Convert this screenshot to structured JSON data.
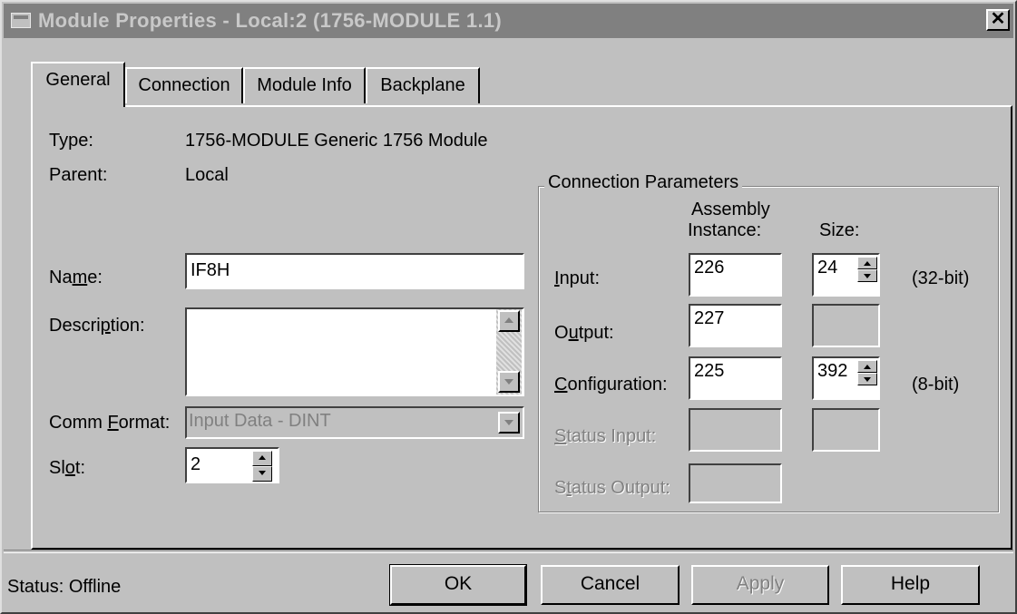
{
  "window": {
    "title": "Module Properties - Local:2 (1756-MODULE 1.1)",
    "close_glyph": "✕"
  },
  "tabs": [
    {
      "label": "General",
      "active": true
    },
    {
      "label": "Connection",
      "active": false
    },
    {
      "label": "Module Info",
      "active": false
    },
    {
      "label": "Backplane",
      "active": false
    }
  ],
  "general": {
    "type_label": "Type:",
    "type_value": "1756-MODULE Generic 1756 Module",
    "parent_label": "Parent:",
    "parent_value": "Local",
    "name_label_pre": "Na",
    "name_label_key": "m",
    "name_label_post": "e:",
    "name_value": "IF8H",
    "description_label_pre": "Descri",
    "description_label_key": "p",
    "description_label_post": "tion:",
    "description_value": "",
    "comm_format_label_pre": "Comm ",
    "comm_format_label_key": "F",
    "comm_format_label_post": "ormat:",
    "comm_format_value": "Input Data - DINT",
    "slot_label_pre": "Sl",
    "slot_label_key": "o",
    "slot_label_post": "t:",
    "slot_value": "2"
  },
  "connection_parameters": {
    "title": "Connection Parameters",
    "header_assembly_line1": "Assembly",
    "header_assembly_line2": "Instance:",
    "header_size": "Size:",
    "input": {
      "label_key": "I",
      "label_post": "nput:",
      "instance": "226",
      "size": "24",
      "unit": "(32-bit)"
    },
    "output": {
      "label_pre": "O",
      "label_key": "u",
      "label_post": "tput:",
      "instance": "227",
      "size": ""
    },
    "configuration": {
      "label_key": "C",
      "label_post": "onfiguration:",
      "instance": "225",
      "size": "392",
      "unit": "(8-bit)"
    },
    "status_input": {
      "label_key": "S",
      "label_post": "tatus Input:",
      "instance": "",
      "size": ""
    },
    "status_output": {
      "label_pre": "S",
      "label_key": "t",
      "label_post": "atus Output:",
      "instance": ""
    }
  },
  "footer": {
    "status_text": "Status:  Offline",
    "ok_label": "OK",
    "cancel_label": "Cancel",
    "apply_label": "Apply",
    "help_label": "Help"
  },
  "icons": [
    "window-menu-icon",
    "close-icon",
    "spin-up-icon",
    "spin-down-icon",
    "scroll-up-icon",
    "scroll-down-icon",
    "dropdown-arrow-icon"
  ]
}
